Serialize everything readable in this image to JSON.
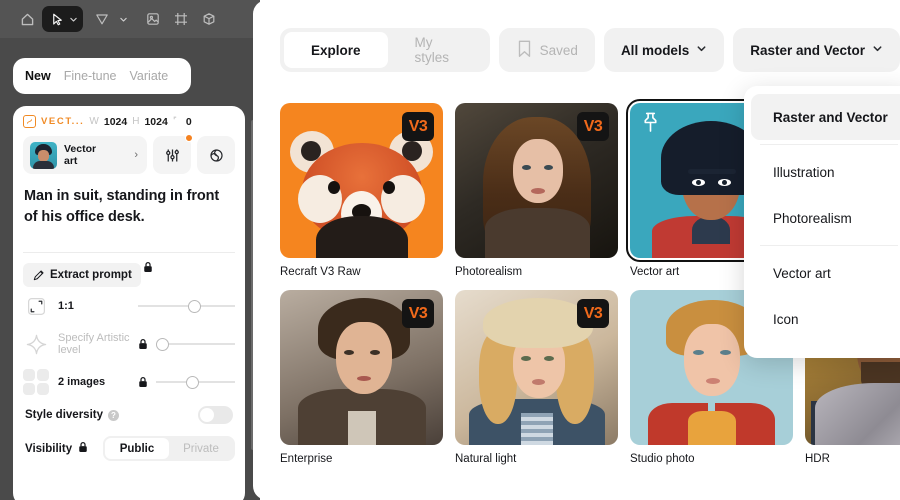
{
  "workspace": {
    "toolbar": {
      "icons": [
        {
          "name": "home-icon",
          "glyph": "home"
        },
        {
          "name": "select-tool-icon",
          "glyph": "cursor"
        },
        {
          "name": "tool-chevron-down-icon",
          "glyph": "chevron"
        },
        {
          "name": "shape-tool-icon",
          "glyph": "triangle"
        },
        {
          "name": "shape-chevron-down-icon",
          "glyph": "chevron"
        },
        {
          "name": "image-tool-icon",
          "glyph": "image"
        },
        {
          "name": "frame-tool-icon",
          "glyph": "frame"
        },
        {
          "name": "mockup-tool-icon",
          "glyph": "mockup"
        }
      ]
    },
    "tabs": [
      {
        "label": "New",
        "active": true
      },
      {
        "label": "Fine-tune",
        "active": false
      },
      {
        "label": "Variate",
        "active": false
      }
    ],
    "meta": {
      "layer_name": "VECT...",
      "width_label": "W",
      "width_value": "1024",
      "height_label": "H",
      "height_value": "1024",
      "rotation_value": "0"
    },
    "style": {
      "name_line1": "Vector",
      "name_line2": "art",
      "arrow": "›",
      "settings_icon": "sliders-icon",
      "shuffle_icon": "shuffle-icon"
    },
    "prompt_text": "Man in suit, standing in front of his office desk.",
    "extract_prompt_label": "Extract prompt",
    "controls": [
      {
        "name": "aspect-ratio",
        "label": "1:1",
        "dim": false,
        "locked": false,
        "knob": 52
      },
      {
        "name": "artistic-level",
        "label": "Specify Artistic level",
        "dim": true,
        "locked": true,
        "knob": 6
      },
      {
        "name": "image-count",
        "label": "2 images",
        "dim": false,
        "locked": true,
        "knob": 40
      }
    ],
    "style_diversity": {
      "label": "Style diversity",
      "enabled": false,
      "help": "?"
    },
    "visibility": {
      "label": "Visibility",
      "options": [
        {
          "label": "Public",
          "active": true
        },
        {
          "label": "Private",
          "active": false
        }
      ]
    }
  },
  "main": {
    "tabs": [
      {
        "label": "Explore",
        "active": true
      },
      {
        "label": "My styles",
        "active": false
      }
    ],
    "saved_label": "Saved",
    "saved_icon": "bookmark-icon",
    "models_filter": "All models",
    "type_filter": "Raster and Vector",
    "dropdown": {
      "items": [
        {
          "label": "Raster and Vector",
          "highlighted": true,
          "separator_after": true
        },
        {
          "label": "Illustration",
          "highlighted": false,
          "separator_after": false
        },
        {
          "label": "Photorealism",
          "highlighted": false,
          "separator_after": true
        },
        {
          "label": "Vector art",
          "highlighted": false,
          "separator_after": false
        },
        {
          "label": "Icon",
          "highlighted": false,
          "separator_after": false
        }
      ]
    },
    "cards": [
      {
        "label": "Recraft V3 Raw",
        "badge": "V3",
        "art": "ar-panda",
        "selected": false,
        "pinned": false
      },
      {
        "label": "Photorealism",
        "badge": "V3",
        "art": "ar-photo1",
        "selected": false,
        "pinned": false
      },
      {
        "label": "Vector art",
        "badge": "",
        "art": "ar-vector",
        "selected": true,
        "pinned": true
      },
      {
        "label": "",
        "badge": "",
        "art": "ar-hidden",
        "selected": false,
        "pinned": false
      },
      {
        "label": "Enterprise",
        "badge": "V3",
        "art": "ar-ent",
        "selected": false,
        "pinned": false
      },
      {
        "label": "Natural light",
        "badge": "V3",
        "art": "ar-nat",
        "selected": false,
        "pinned": false
      },
      {
        "label": "Studio photo",
        "badge": "",
        "art": "ar-studio",
        "selected": false,
        "pinned": false
      },
      {
        "label": "HDR",
        "badge": "",
        "art": "ar-hdr",
        "selected": false,
        "pinned": false
      }
    ]
  },
  "colors": {
    "accent_orange": "#f26a1b",
    "workspace_bg": "#4a4a4a",
    "toolbar_bg": "#545454",
    "panel_bg": "#ffffff"
  }
}
